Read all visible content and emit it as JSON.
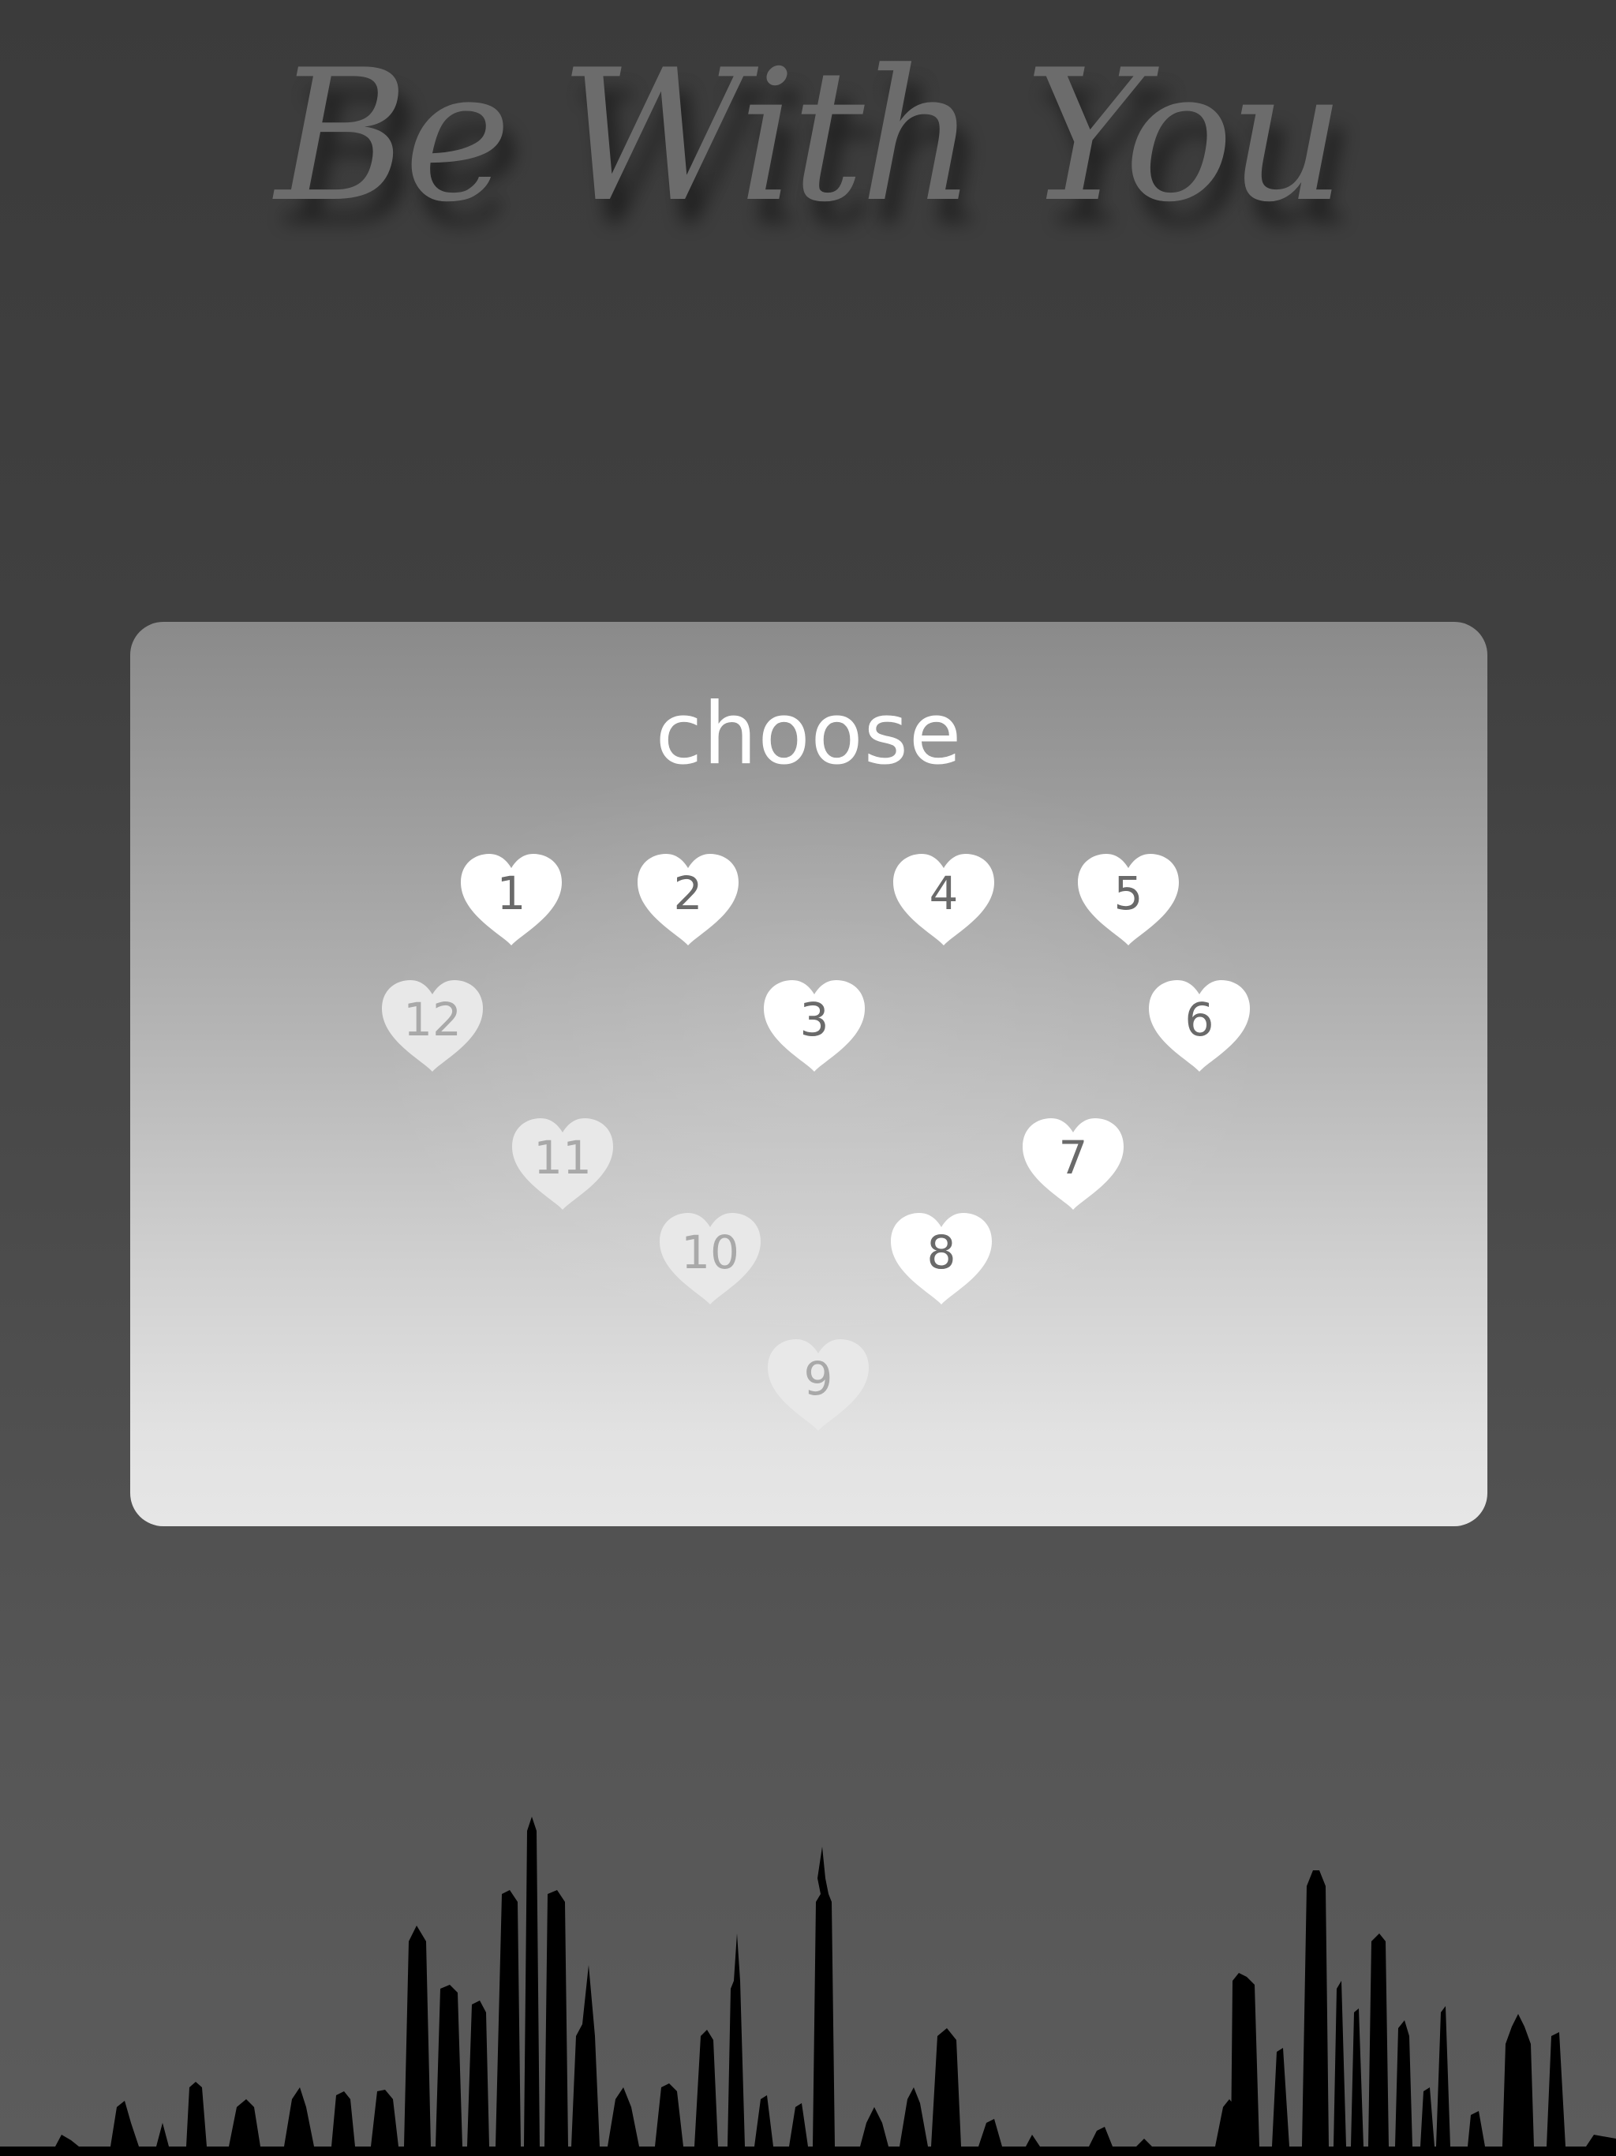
{
  "title": "Be With You",
  "panel": {
    "heading": "choose"
  },
  "hearts": [
    {
      "label": "1",
      "state": "active"
    },
    {
      "label": "2",
      "state": "active"
    },
    {
      "label": "3",
      "state": "active"
    },
    {
      "label": "4",
      "state": "active"
    },
    {
      "label": "5",
      "state": "active"
    },
    {
      "label": "6",
      "state": "active"
    },
    {
      "label": "7",
      "state": "active"
    },
    {
      "label": "8",
      "state": "active"
    },
    {
      "label": "9",
      "state": "locked"
    },
    {
      "label": "10",
      "state": "locked"
    },
    {
      "label": "11",
      "state": "locked"
    },
    {
      "label": "12",
      "state": "locked"
    }
  ],
  "colors": {
    "heart_active": "#ffffff",
    "heart_locked": "#e8e8e8",
    "number_active": "#6a6a6a",
    "number_locked": "#a9a9a9",
    "skyline": "#000000"
  }
}
